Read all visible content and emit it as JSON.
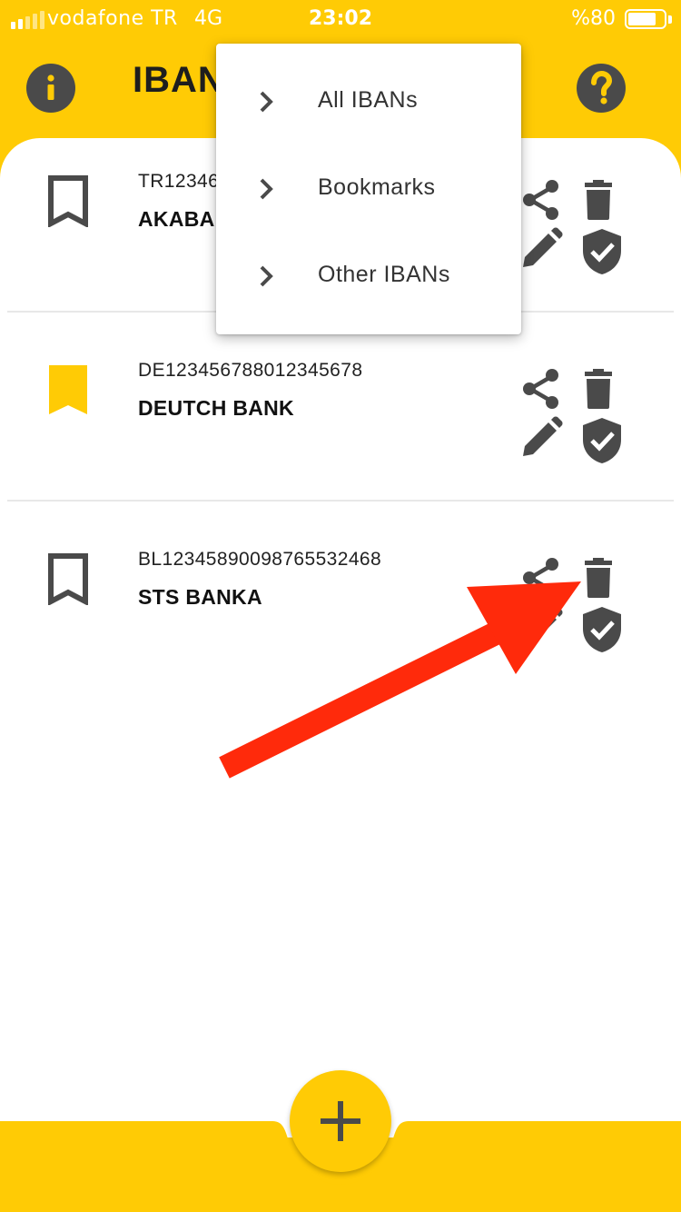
{
  "status_bar": {
    "carrier": "vodafone TR",
    "network": "4G",
    "time": "23:02",
    "battery_percent": "%80",
    "battery_level": 0.8
  },
  "header": {
    "title": "IBAN",
    "info_icon": "info-icon",
    "help_icon": "help-icon"
  },
  "menu": {
    "items": [
      {
        "label": "All IBANs",
        "icon": "chevron-right-icon"
      },
      {
        "label": "Bookmarks",
        "icon": "chevron-right-icon"
      },
      {
        "label": "Other IBANs",
        "icon": "chevron-right-icon"
      }
    ]
  },
  "ibans": [
    {
      "iban": "TR12346",
      "bank": "AKABAI",
      "bookmarked": false
    },
    {
      "iban": "DE123456788012345678",
      "bank": "DEUTCH BANK",
      "bookmarked": true
    },
    {
      "iban": "BL12345890098765532468",
      "bank": "STS BANKA",
      "bookmarked": false
    }
  ],
  "actions": [
    "share-icon",
    "trash-icon",
    "edit-icon",
    "shield-check-icon"
  ],
  "fab": {
    "icon": "plus-icon"
  },
  "colors": {
    "brand_yellow": "#FFCB05",
    "icon_gray": "#4a4a4a",
    "annotation_red": "#FF2A0B"
  }
}
